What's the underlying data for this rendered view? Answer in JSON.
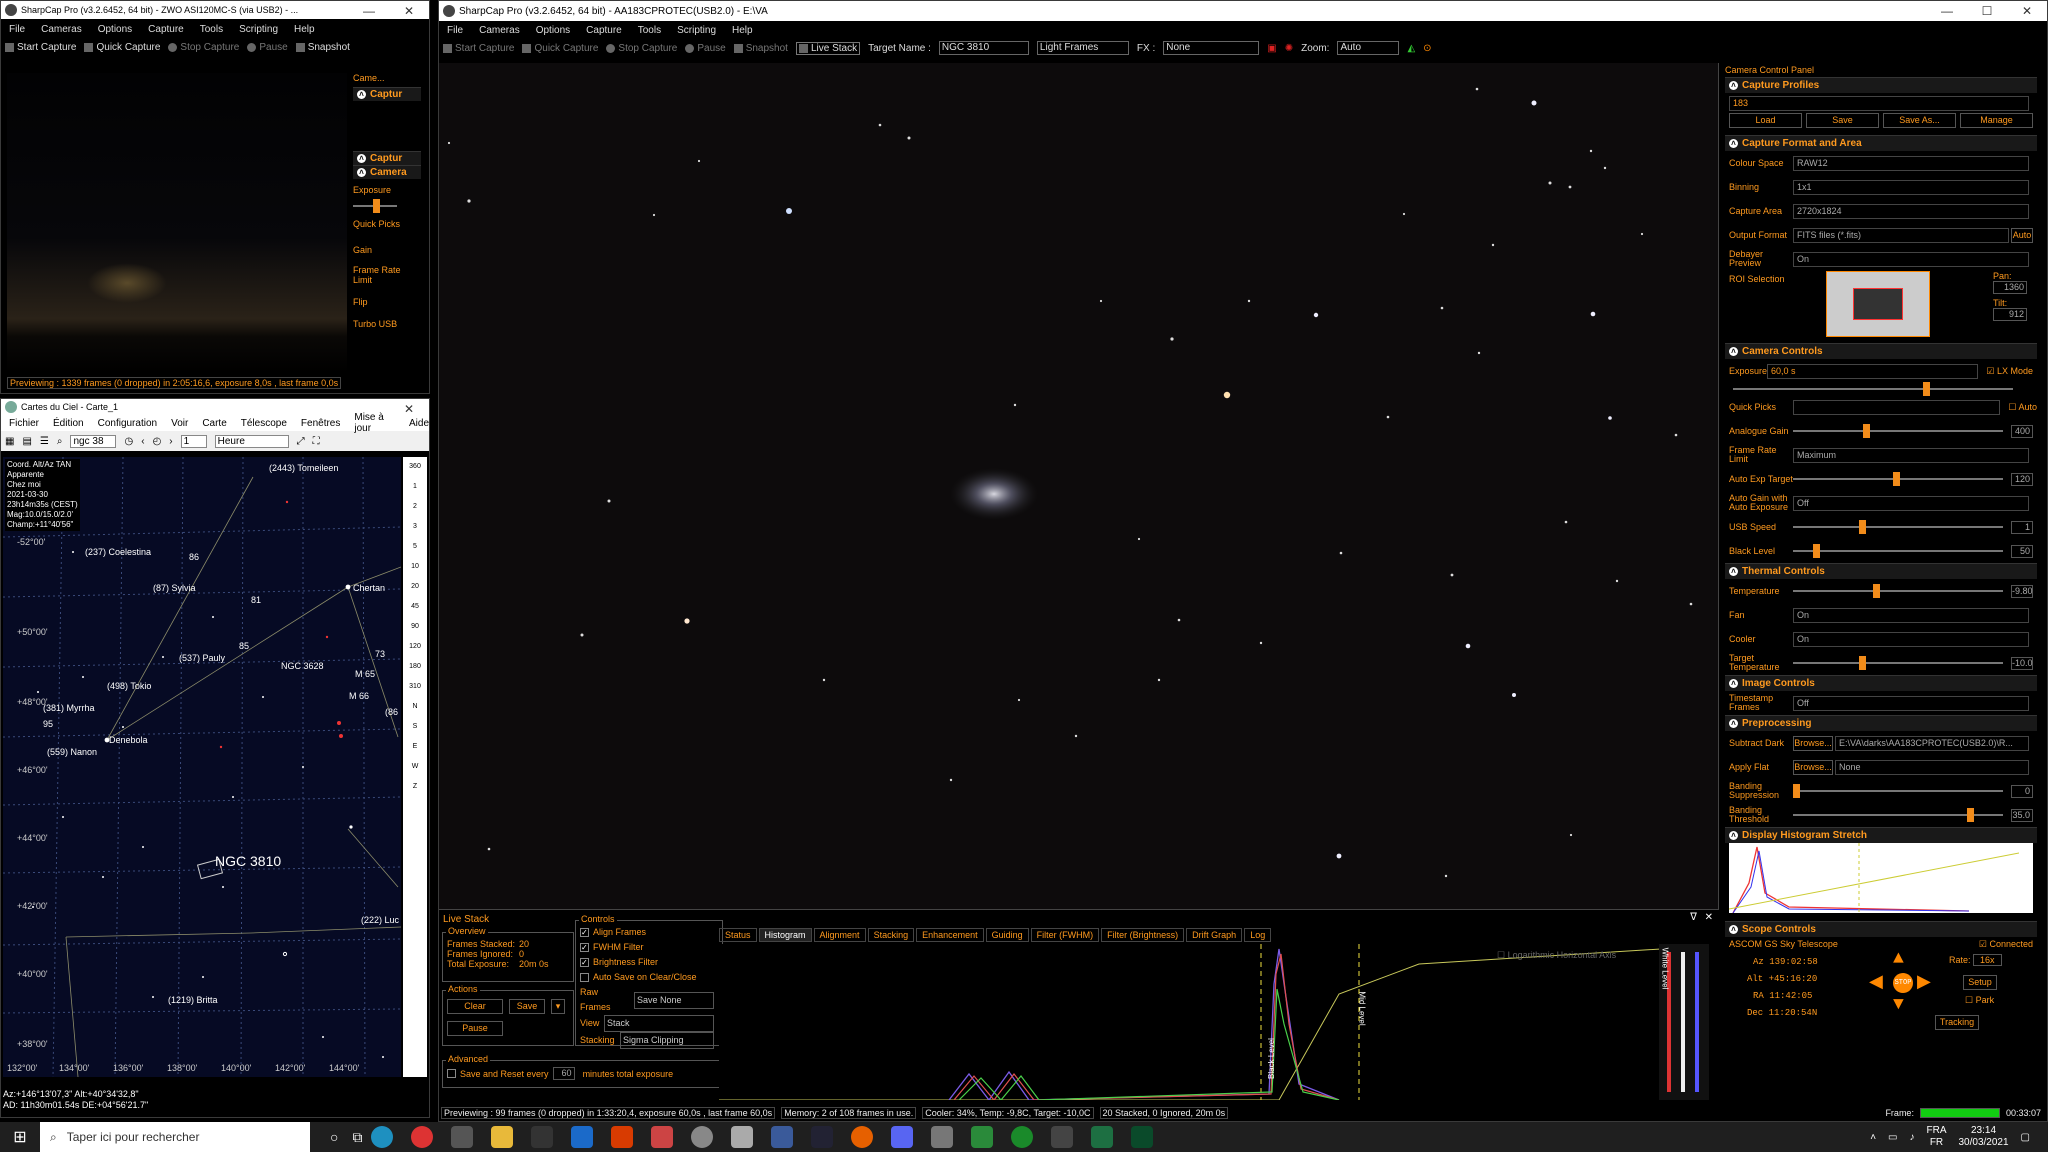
{
  "main": {
    "title": "SharpCap Pro (v3.2.6452, 64 bit) - AA183CPROTEC(USB2.0) - E:\\VA",
    "menu": [
      "File",
      "Cameras",
      "Options",
      "Capture",
      "Tools",
      "Scripting",
      "Help"
    ],
    "toolbar": {
      "start": "Start Capture",
      "quick": "Quick Capture",
      "stop": "Stop Capture",
      "pause": "Pause",
      "snapshot": "Snapshot",
      "livestack": "Live Stack",
      "target_label": "Target Name :",
      "target_value": "NGC 3810",
      "frame_type": "Light Frames",
      "fx_label": "FX :",
      "fx_value": "None",
      "zoom_label": "Zoom:",
      "zoom_value": "Auto"
    },
    "status": [
      "Previewing : 99 frames (0 dropped) in 1:33:20,4, exposure 60,0s , last frame 60,0s",
      "Memory: 2 of 108 frames in use.",
      "Cooler: 34%, Temp: -9,8C, Target: -10,0C",
      "20 Stacked, 0 Ignored, 20m 0s"
    ],
    "frame_label": "Frame:",
    "frame_time": "00:33:07"
  },
  "livestack": {
    "title": "Live Stack",
    "overview_title": "Overview",
    "frames_stacked_label": "Frames Stacked:",
    "frames_stacked": "20",
    "frames_ignored_label": "Frames Ignored:",
    "frames_ignored": "0",
    "total_exposure_label": "Total Exposure:",
    "total_exposure": "20m 0s",
    "actions_title": "Actions",
    "clear": "Clear",
    "save": "Save",
    "pause": "Pause",
    "controls_title": "Controls",
    "checks": [
      "Align Frames",
      "FWHM Filter",
      "Brightness Filter",
      "Auto Save on Clear/Close"
    ],
    "raw_frames_label": "Raw Frames",
    "raw_frames_value": "Save None",
    "view_label": "View",
    "view_value": "Stack",
    "stacking_label": "Stacking",
    "stacking_value": "Sigma Clipping",
    "advanced_title": "Advanced",
    "save_reset": "Save and Reset every",
    "save_reset_val": "60",
    "save_reset_suffix": "minutes total exposure",
    "tabs": [
      "Status",
      "Histogram",
      "Alignment",
      "Stacking",
      "Enhancement",
      "Guiding",
      "Filter (FWHM)",
      "Filter (Brightness)",
      "Drift Graph",
      "Log"
    ],
    "log_axis": "Logarithmic Horizontal Axis",
    "black_level": "Black Level",
    "mid_level": "Mid Level",
    "white_level": "White Level"
  },
  "ccp": {
    "title": "Camera Control Panel",
    "capture_profiles": "Capture Profiles",
    "profile_value": "183",
    "profile_buttons": [
      "Load",
      "Save",
      "Save As...",
      "Manage"
    ],
    "format_area": "Capture Format and Area",
    "colour_space_label": "Colour Space",
    "colour_space": "RAW12",
    "binning_label": "Binning",
    "binning": "1x1",
    "capture_area_label": "Capture Area",
    "capture_area": "2720x1824",
    "output_label": "Output Format",
    "output": "FITS files (*.fits)",
    "auto": "Auto",
    "debayer_label": "Debayer Preview",
    "debayer": "On",
    "roi_label": "ROI Selection",
    "pan_label": "Pan:",
    "pan": "1360",
    "tilt_label": "Tilt:",
    "tilt": "912",
    "camera_controls": "Camera Controls",
    "exposure_label": "Exposure",
    "exposure": "60,0 s",
    "lx_mode": "LX Mode",
    "quick_picks": "Quick Picks",
    "auto2": "Auto",
    "gain_label": "Analogue Gain",
    "gain": "400",
    "frame_rate_label": "Frame Rate Limit",
    "frame_rate": "Maximum",
    "auto_exp_label": "Auto Exp Target",
    "auto_exp": "120",
    "auto_gain_label": "Auto Gain with Auto Exposure",
    "auto_gain": "Off",
    "usb_label": "USB Speed",
    "usb": "1",
    "black_label": "Black Level",
    "black": "50",
    "thermal": "Thermal Controls",
    "temp_label": "Temperature",
    "temp": "-9.80",
    "fan_label": "Fan",
    "fan": "On",
    "cooler_label": "Cooler",
    "cooler": "On",
    "target_temp_label": "Target Temperature",
    "target_temp": "-10.0",
    "image_controls": "Image Controls",
    "timestamp_label": "Timestamp Frames",
    "timestamp": "Off",
    "preprocessing": "Preprocessing",
    "dark_label": "Subtract Dark",
    "browse": "Browse...",
    "dark": "E:\\VA\\darks\\AA183CPROTEC(USB2.0)\\R...",
    "flat_label": "Apply Flat",
    "flat": "None",
    "banding_sup_label": "Banding Suppression",
    "banding_sup": "0",
    "banding_thr_label": "Banding Threshold",
    "banding_thr": "35.0",
    "histogram": "Display Histogram Stretch",
    "scope": "Scope Controls",
    "scope_name": "ASCOM GS Sky Telescope",
    "connected": "Connected",
    "az_label": "Az",
    "az": "139:02:58",
    "alt_label": "Alt",
    "alt": "+45:16:20",
    "ra_label": "RA",
    "ra": "11:42:05",
    "dec_label": "Dec",
    "dec": "11:20:54N",
    "rate_label": "Rate:",
    "rate": "16x",
    "setup": "Setup",
    "park": "Park",
    "tracking": "Tracking",
    "stop": "STOP"
  },
  "small": {
    "title": "SharpCap Pro (v3.2.6452, 64 bit) - ZWO ASI120MC-S (via USB2) - ...",
    "menu": [
      "File",
      "Cameras",
      "Options",
      "Capture",
      "Tools",
      "Scripting",
      "Help"
    ],
    "toolbar": {
      "start": "Start Capture",
      "quick": "Quick Capture",
      "stop": "Stop Capture",
      "pause": "Pause",
      "snapshot": "Snapshot"
    },
    "side": [
      "Came...",
      "Captur",
      "Captur",
      "Camera",
      "Exposure",
      "Quick Picks",
      "Gain",
      "Frame Rate Limit",
      "Flip",
      "Turbo USB"
    ],
    "status": "Previewing : 1339 frames (0 dropped) in 2:05:16,6, exposure 8,0s , last frame 0,0s"
  },
  "cdc": {
    "title": "Cartes du Ciel - Carte_1",
    "menu": [
      "Fichier",
      "Édition",
      "Configuration",
      "Voir",
      "Carte",
      "Télescope",
      "Fenêtres",
      "Mise à jour",
      "Aide"
    ],
    "search": "ngc 38",
    "step": "1",
    "unit": "Heure",
    "info": [
      "Coord. Alt/Az TAN",
      "Apparente",
      "Chez moi",
      "2021-03-30",
      "23h14m35s (CEST)",
      "Mag:10.0/15.0/2.0'",
      "Champ:+11°40'56\""
    ],
    "labels": [
      "(2443) Tomeileen",
      "(237) Coelestina",
      "86",
      "(87) Sylvia",
      "81",
      "Chertan",
      "85",
      "(537) Pauly",
      "NGC 3628",
      "73",
      "M 65",
      "M 66",
      "(86",
      "(498) Tokio",
      "(381) Myrrha",
      "95",
      "Denebola",
      "(559) Nanon",
      "(222) Luc",
      "(1219) Britta",
      "NGC 3810"
    ],
    "dec_ticks": [
      "-52°00'",
      "+50°00'",
      "+48°00'",
      "+46°00'",
      "+44°00'",
      "+42°00'",
      "+40°00'",
      "+38°00'"
    ],
    "ra_ticks": [
      "132°00'",
      "134°00'",
      "136°00'",
      "138°00'",
      "140°00'",
      "142°00'",
      "144°00'"
    ],
    "side_scale": [
      "360",
      "1",
      "2",
      "3",
      "5",
      "10",
      "20",
      "45",
      "90",
      "120",
      "180",
      "310",
      "N",
      "S",
      "E",
      "W",
      "Z"
    ],
    "status1": "Az:+146°13'07,3\" Alt:+40°34'32,8\"",
    "status2": "AD: 11h30m01.54s DE:+04°56'21.7\""
  },
  "taskbar": {
    "search": "Taper ici pour rechercher",
    "lang": "FRA",
    "lang2": "FR",
    "time": "23:14",
    "date": "30/03/2021"
  }
}
